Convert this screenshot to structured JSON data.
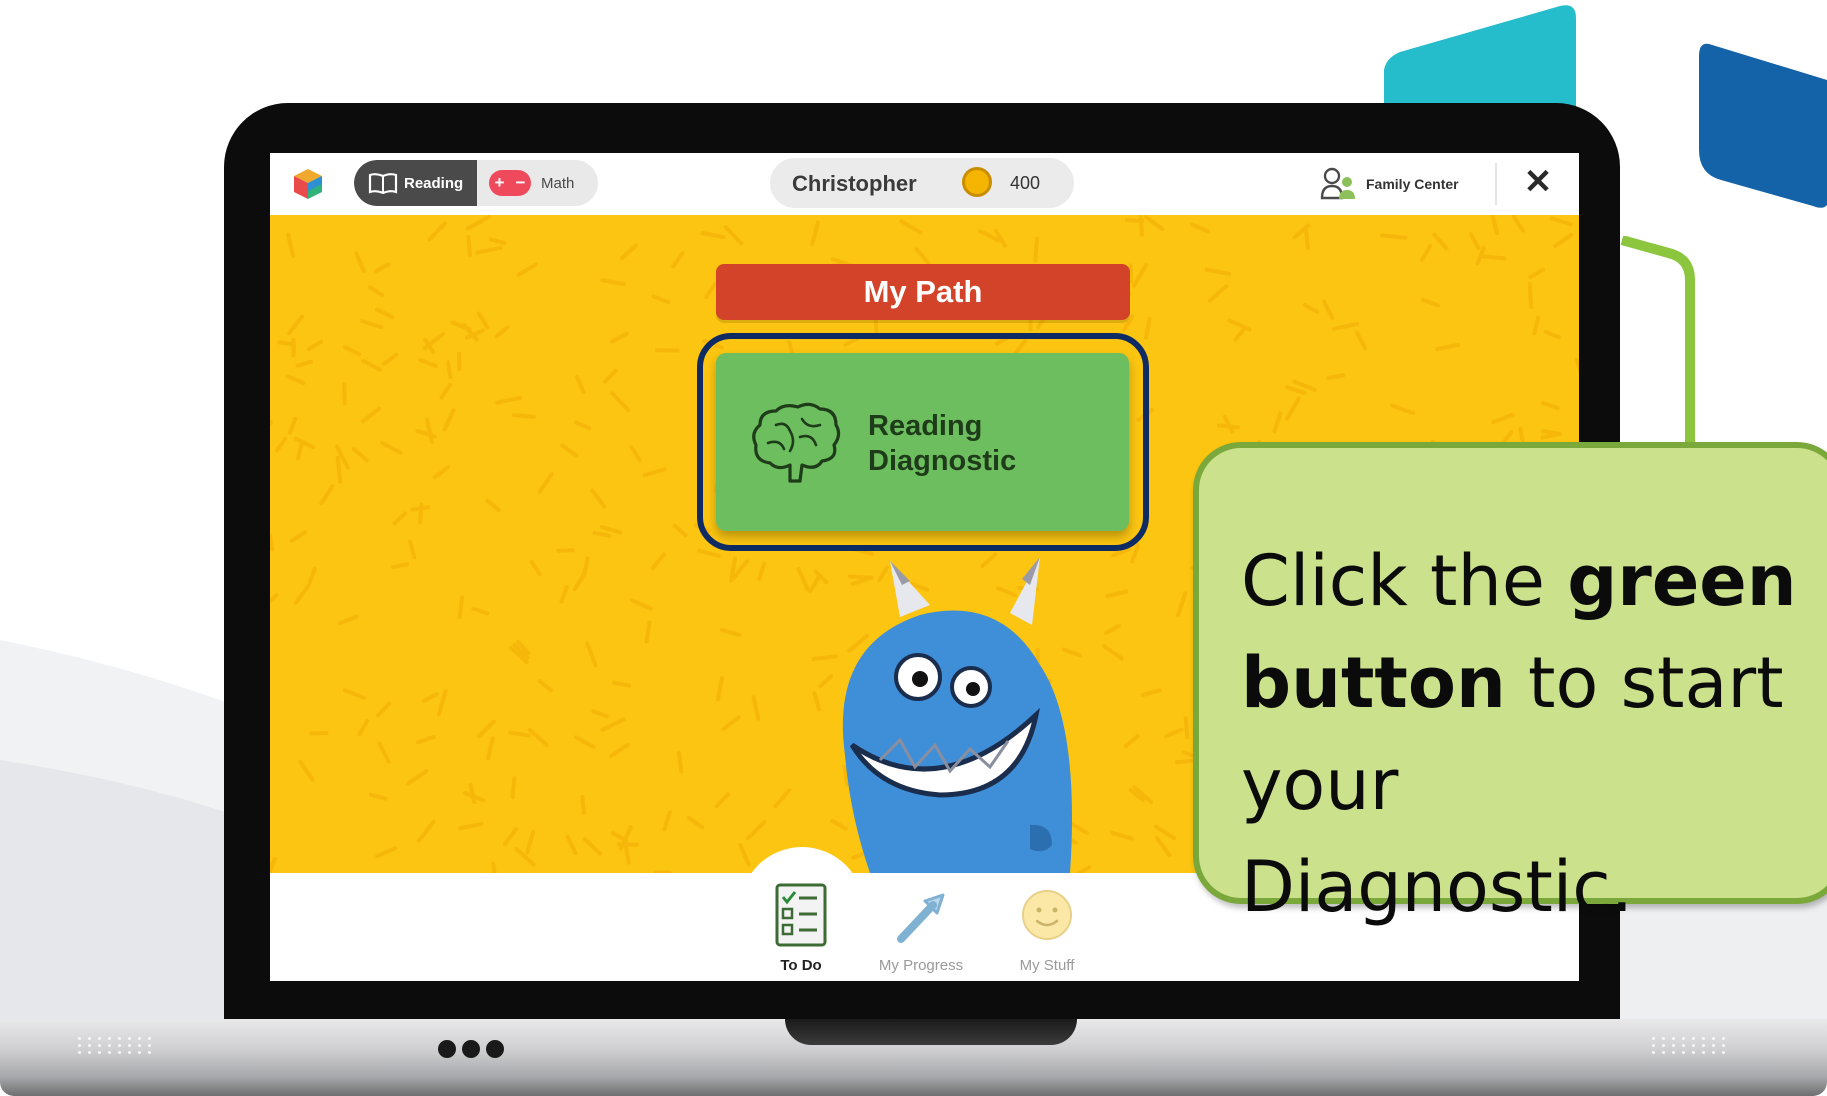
{
  "app": {
    "subjects": [
      {
        "label": "Reading",
        "active": true
      },
      {
        "label": "Math",
        "active": false
      }
    ],
    "user": {
      "name": "Christopher",
      "coins": "400"
    },
    "family_center_label": "Family Center"
  },
  "path": {
    "title": "My Path",
    "button_line1": "Reading",
    "button_line2": "Diagnostic"
  },
  "bottom_nav": [
    {
      "label": "To Do",
      "active": true
    },
    {
      "label": "My Progress",
      "active": false
    },
    {
      "label": "My Stuff",
      "active": false
    }
  ],
  "callout": {
    "part1": "Click the ",
    "bold1": "green",
    "bold2": "button",
    "part2": " to start your Diagnostic."
  },
  "colors": {
    "accent_yellow": "#fbc511",
    "path_red": "#d2432a",
    "button_green": "#6dbe5e",
    "highlight_navy": "#0f2b63",
    "callout_green": "#cbe18c",
    "math_pink": "#ef4a5c"
  },
  "icons": [
    "cube-logo-icon",
    "book-icon",
    "plus-minus-icon",
    "coin-icon",
    "family-icon",
    "close-icon",
    "brain-icon",
    "checklist-icon",
    "arrow-progress-icon",
    "smiley-icon"
  ]
}
